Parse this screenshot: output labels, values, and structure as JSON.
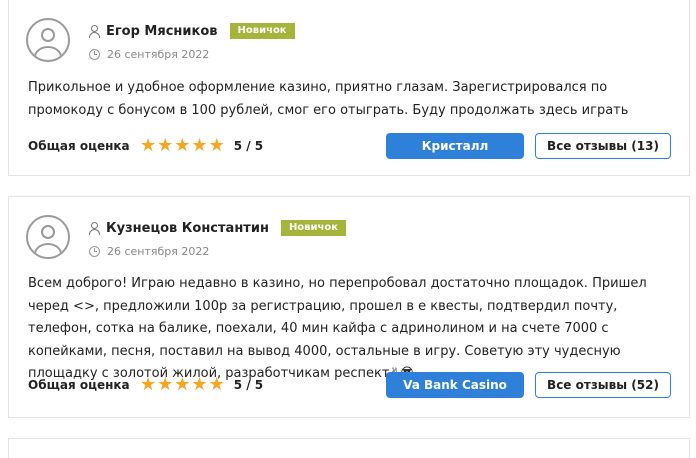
{
  "reviews": [
    {
      "author": "Егор Мясников",
      "badge": "Новичок",
      "date": "26 сентября 2022",
      "text": "Прикольное и удобное оформление казино, приятно глазам. Зарегистрировался по промокоду с бонусом в 100 рублей, смог его отыграть. Буду продолжать здесь играть",
      "rating_label": "Общая оценка",
      "stars": 5,
      "score": "5 / 5",
      "casino_button": "Кристалл",
      "all_reviews_button": "Все отзывы (13)"
    },
    {
      "author": "Кузнецов Константин",
      "badge": "Новичок",
      "date": "26 сентября 2022",
      "text": "Всем доброго! Играю недавно в казино, но перепробовал достаточно площадок. Пришел черед <>, предложили 100р за регистрацию, прошел в е квесты, подтвердил почту, телефон, сотка на балике, поехали, 40 мин кайфа с адринолином и на счете 7000 с копейками, песня, поставил на вывод 4000, остальные в игру. Советую эту чудесную площадку с золотой жилой, разработчикам респект✌😎",
      "rating_label": "Общая оценка",
      "stars": 5,
      "score": "5 / 5",
      "casino_button": "Va Bank Casino",
      "all_reviews_button": "Все отзывы (52)"
    }
  ],
  "colors": {
    "badge": "#a5b43a",
    "primary": "#2f80d8",
    "star": "#f5a623"
  }
}
